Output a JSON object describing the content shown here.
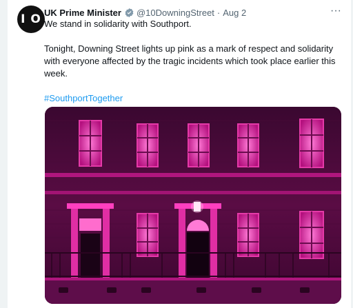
{
  "tweet": {
    "avatar_text": "I O",
    "author_name": "UK Prime Minister",
    "verified_icon": "verified-badge-icon",
    "handle": "@10DowningStreet",
    "separator": "·",
    "date": "Aug 2",
    "more_icon": "more-horizontal-icon",
    "more_label": "···",
    "text_line1": "We stand in solidarity with Southport.",
    "text_para2": "Tonight, Downing Street lights up pink as a mark of respect and solidarity with everyone affected by the tragic incidents which took place earlier this week.",
    "hashtag": "#SouthportTogether",
    "media": {
      "description_icon": "photo-icon",
      "accent_color": "#ff2fb4"
    }
  },
  "colors": {
    "link": "#1d9bf0",
    "secondary_text": "#536471",
    "primary_text": "#0f1419"
  }
}
